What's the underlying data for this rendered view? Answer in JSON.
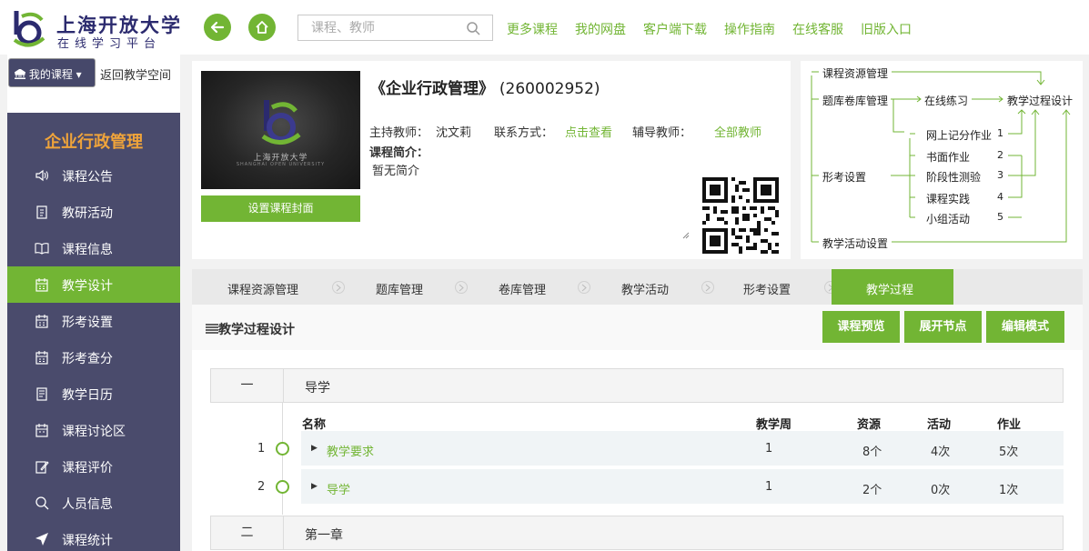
{
  "header": {
    "logo_title": "上海开放大学",
    "logo_subtitle": "在线学习平台",
    "search_placeholder": "课程、教师",
    "nav": [
      "更多课程",
      "我的网盘",
      "客户端下载",
      "操作指南",
      "在线客服",
      "旧版入口"
    ]
  },
  "sidebar": {
    "my_course": "我的课程",
    "back_link": "返回教学空间",
    "course_title": "企业行政管理",
    "items": [
      {
        "label": "课程公告",
        "icon": "speaker-icon"
      },
      {
        "label": "教研活动",
        "icon": "clipboard-icon"
      },
      {
        "label": "课程信息",
        "icon": "book-icon"
      },
      {
        "label": "教学设计",
        "icon": "calendar-icon",
        "active": true
      },
      {
        "label": "形考设置",
        "icon": "calendar-icon"
      },
      {
        "label": "形考查分",
        "icon": "calendar-icon"
      },
      {
        "label": "教学日历",
        "icon": "list-icon"
      },
      {
        "label": "课程讨论区",
        "icon": "calendar-icon"
      },
      {
        "label": "课程评价",
        "icon": "edit-icon"
      },
      {
        "label": "人员信息",
        "icon": "search-icon"
      },
      {
        "label": "课程统计",
        "icon": "send-icon"
      }
    ]
  },
  "course": {
    "cover_text": "上海开放大学",
    "cover_subtext": "SHANGHAI OPEN UNIVERSITY",
    "set_cover_button": "设置课程封面",
    "title": "《企业行政管理》",
    "code": "(260002952)",
    "host_label": "主持教师：",
    "host_name": "沈文莉",
    "contact_label": "联系方式：",
    "contact_link": "点击查看",
    "assist_label": "辅导教师：",
    "assist_link": "全部教师",
    "intro_label": "课程简介：",
    "intro_text": "暂无简介"
  },
  "flow": {
    "resource": "课程资源管理",
    "bank": "题库卷库管理",
    "practice": "在线练习",
    "design": "教学过程设计",
    "formative": "形考设置",
    "activity": "教学活动设置",
    "items": [
      {
        "label": "网上记分作业",
        "num": "1"
      },
      {
        "label": "书面作业",
        "num": "2"
      },
      {
        "label": "阶段性测验",
        "num": "3"
      },
      {
        "label": "课程实践",
        "num": "4"
      },
      {
        "label": "小组活动",
        "num": "5"
      }
    ]
  },
  "tabs": [
    "课程资源管理",
    "题库管理",
    "卷库管理",
    "教学活动",
    "形考设置",
    "教学过程"
  ],
  "active_tab": "教学过程",
  "panel": {
    "title": "教学过程设计",
    "buttons": [
      "课程预览",
      "展开节点",
      "编辑模式"
    ]
  },
  "table": {
    "headers": [
      "名称",
      "教学周",
      "资源",
      "活动",
      "作业"
    ],
    "chapters": [
      {
        "num": "一",
        "name": "导学"
      },
      {
        "num": "二",
        "name": "第一章"
      }
    ],
    "rows": [
      {
        "index": "1",
        "name": "教学要求",
        "week": "1",
        "resources": "8个",
        "activities": "4次",
        "homework": "5次"
      },
      {
        "index": "2",
        "name": "导学",
        "week": "1",
        "resources": "2个",
        "activities": "0次",
        "homework": "1次"
      }
    ]
  },
  "colors": {
    "accent": "#72b534",
    "sidebar": "#4a4b6c",
    "brand": "#2b2a6e",
    "highlight": "#f0a43a"
  }
}
